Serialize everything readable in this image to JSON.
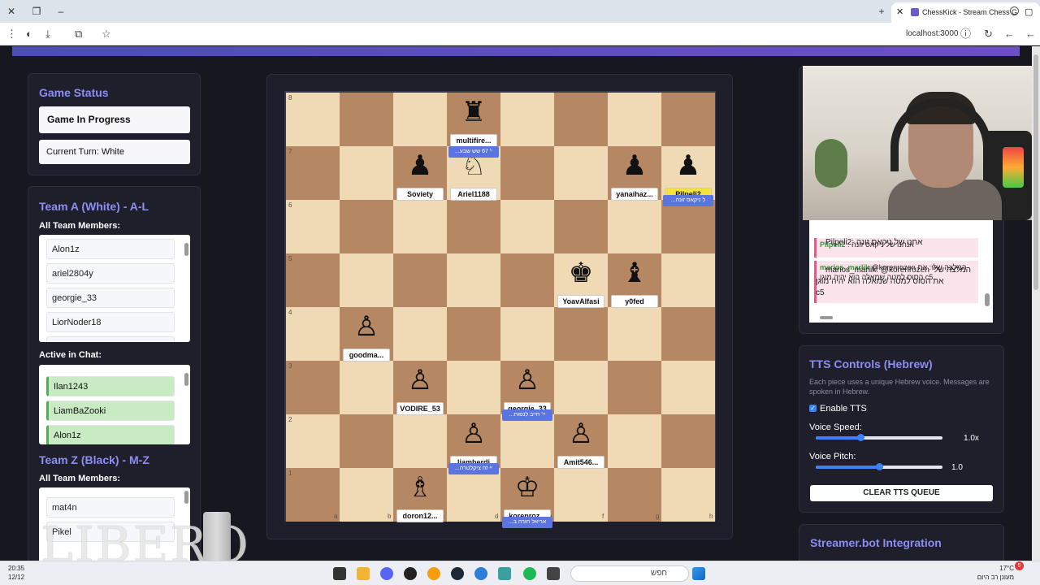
{
  "browser": {
    "tab_title": "ChessKick - Stream Chess G",
    "url": "localhost:3000"
  },
  "game_status": {
    "title": "Game Status",
    "state": "Game In Progress",
    "turn": "Current Turn: White"
  },
  "team_a": {
    "title": "Team A (White) - A-L",
    "members_label": "All Team Members:",
    "members": [
      "Alon1z",
      "ariel2804y",
      "georgie_33",
      "LiorNoder18"
    ],
    "active_label": "Active in Chat:",
    "active": [
      "Ilan1243",
      "LiamBaZooki",
      "Alon1z"
    ]
  },
  "team_z": {
    "title": "Team Z (Black) - M-Z",
    "members_label": "All Team Members:",
    "members": [
      "mat4n",
      "Pikel"
    ]
  },
  "board": {
    "ranks": [
      "8",
      "7",
      "6",
      "5",
      "4",
      "3",
      "2",
      "1"
    ],
    "files": [
      "a",
      "b",
      "c",
      "d",
      "e",
      "f",
      "g",
      "h"
    ],
    "pieces": [
      {
        "glyph": "♜",
        "label": "multifire...",
        "highlight": false
      },
      {
        "glyph": "♟",
        "label": "Soviety",
        "highlight": false
      },
      {
        "glyph": "♘",
        "label": "Ariel1188",
        "highlight": false
      },
      {
        "glyph": "♟",
        "label": "yanaihaz...",
        "highlight": false
      },
      {
        "glyph": "♟",
        "label": "Pilpeli2",
        "highlight": true
      },
      {
        "glyph": "♚",
        "label": "YoavAlfasi",
        "highlight": false
      },
      {
        "glyph": "♝",
        "label": "y0fed",
        "highlight": false
      },
      {
        "glyph": "♙",
        "label": "goodma...",
        "highlight": false
      },
      {
        "glyph": "♙",
        "label": "VODIRE_53",
        "highlight": false
      },
      {
        "glyph": "♙",
        "label": "georgie_33",
        "highlight": false
      },
      {
        "glyph": "♙",
        "label": "liamberdi",
        "highlight": false
      },
      {
        "glyph": "♙",
        "label": "Amit546...",
        "highlight": false
      },
      {
        "glyph": "♗",
        "label": "doron12...",
        "highlight": false
      },
      {
        "glyph": "♔",
        "label": "korenroz...",
        "highlight": false
      }
    ],
    "bubbles": [
      "...י' 67 שש שבע",
      "...ל ניקאס זונה",
      "...יי' חייב לנסות",
      "...יי זה ציקלטרה",
      "...אריאל חורה ב"
    ]
  },
  "chat": {
    "messages": [
      {
        "user": "Pilpeli2",
        "text": ": אנחנו של ניקאס זונה"
      },
      {
        "user": "marios_marlik",
        "text": "@korenrozen המלצה שלי: את הסוס למטה שמאלה הוא יהיה מוגן c5"
      }
    ],
    "overlap_lines": [
      "Pilpeli2: אחנו של ניקאס זונה",
      "marios_marlik: @korenrozen המלצה שלי",
      "את הסוס למטה שמאלה הוא יהיה מוגן",
      "c5"
    ]
  },
  "tts": {
    "title": "TTS Controls (Hebrew)",
    "desc": "Each piece uses a unique Hebrew voice. Messages are spoken in Hebrew.",
    "enable_label": "Enable TTS",
    "enabled": true,
    "speed_label": "Voice Speed:",
    "speed_value": "1.0x",
    "speed_fraction": 0.35,
    "pitch_label": "Voice Pitch:",
    "pitch_value": "1.0",
    "pitch_fraction": 0.5,
    "clear_label": "CLEAR TTS QUEUE"
  },
  "streamerbot": {
    "title": "Streamer.bot Integration"
  },
  "taskbar": {
    "time": "20:35",
    "date": "12/12",
    "search_text": "חפש",
    "temp": "17°C",
    "weather": "מעונן רב היום",
    "notifications": "5"
  },
  "overlay": {
    "logo_text": "LIBERO"
  }
}
